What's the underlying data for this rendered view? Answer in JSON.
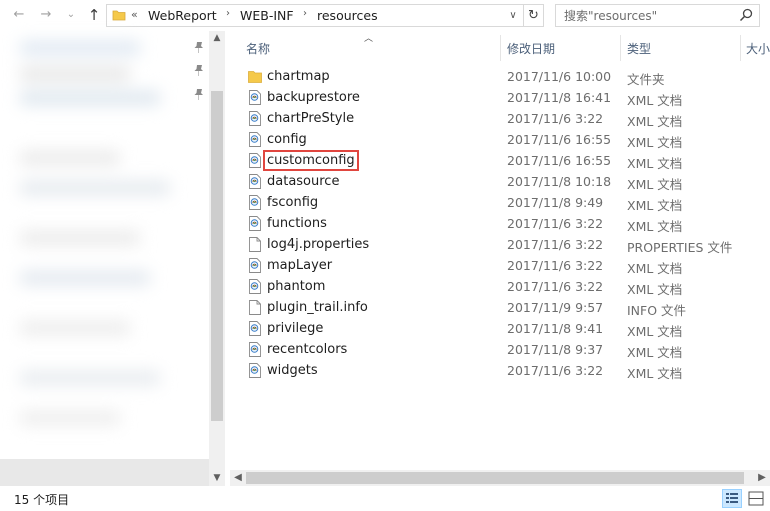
{
  "toolbar": {
    "back_glyph": "←",
    "forward_glyph": "→",
    "history_glyph": "⌄",
    "up_glyph": "↑",
    "overflow_glyph": "«",
    "breadcrumbs": [
      "WebReport",
      "WEB-INF",
      "resources"
    ],
    "crumb_sep": "›",
    "dropdown_glyph": "∨",
    "refresh_glyph": "↻"
  },
  "search": {
    "placeholder": "搜索\"resources\""
  },
  "columns": {
    "name": "名称",
    "modified": "修改日期",
    "type": "类型",
    "size": "大小"
  },
  "files": [
    {
      "name": "chartmap",
      "date": "2017/11/6 10:00",
      "type": "文件夹",
      "kind": "folder"
    },
    {
      "name": "backuprestore",
      "date": "2017/11/8 16:41",
      "type": "XML 文档",
      "kind": "xml"
    },
    {
      "name": "chartPreStyle",
      "date": "2017/11/6 3:22",
      "type": "XML 文档",
      "kind": "xml"
    },
    {
      "name": "config",
      "date": "2017/11/6 16:55",
      "type": "XML 文档",
      "kind": "xml"
    },
    {
      "name": "customconfig",
      "date": "2017/11/6 16:55",
      "type": "XML 文档",
      "kind": "xml",
      "highlighted": true
    },
    {
      "name": "datasource",
      "date": "2017/11/8 10:18",
      "type": "XML 文档",
      "kind": "xml"
    },
    {
      "name": "fsconfig",
      "date": "2017/11/8 9:49",
      "type": "XML 文档",
      "kind": "xml"
    },
    {
      "name": "functions",
      "date": "2017/11/6 3:22",
      "type": "XML 文档",
      "kind": "xml"
    },
    {
      "name": "log4j.properties",
      "date": "2017/11/6 3:22",
      "type": "PROPERTIES 文件",
      "kind": "file"
    },
    {
      "name": "mapLayer",
      "date": "2017/11/6 3:22",
      "type": "XML 文档",
      "kind": "xml"
    },
    {
      "name": "phantom",
      "date": "2017/11/6 3:22",
      "type": "XML 文档",
      "kind": "xml"
    },
    {
      "name": "plugin_trail.info",
      "date": "2017/11/9 9:57",
      "type": "INFO 文件",
      "kind": "file"
    },
    {
      "name": "privilege",
      "date": "2017/11/8 9:41",
      "type": "XML 文档",
      "kind": "xml"
    },
    {
      "name": "recentcolors",
      "date": "2017/11/8 9:37",
      "type": "XML 文档",
      "kind": "xml"
    },
    {
      "name": "widgets",
      "date": "2017/11/6 3:22",
      "type": "XML 文档",
      "kind": "xml"
    }
  ],
  "status": {
    "item_count": "15 个项目"
  },
  "icons": {
    "folder": "folder-icon",
    "xml": "xml-document-icon",
    "file": "generic-file-icon",
    "pin": "pin-icon",
    "search": "search-icon",
    "details_view": "details-view-icon",
    "large_icons_view": "large-icons-view-icon"
  },
  "colors": {
    "highlight_box": "#e0463f",
    "column_header": "#4c607a",
    "folder": "#f5c94a",
    "active_view": "#cce8ff"
  }
}
